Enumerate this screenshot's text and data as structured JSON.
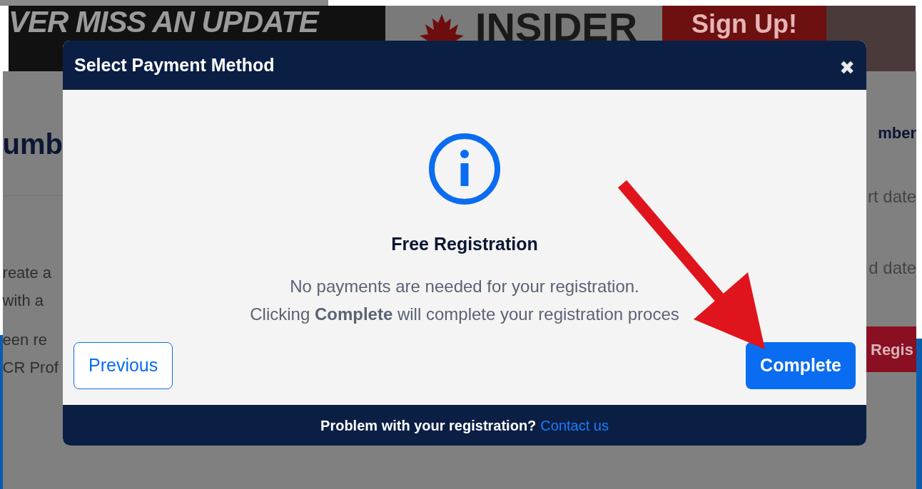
{
  "background_page": {
    "banner": {
      "slogan": "VER MISS AN UPDATE",
      "brand": "INSIDER",
      "cta": "Sign Up!"
    },
    "left_texts": {
      "heading": "umb",
      "lines": [
        "reate a",
        "with a",
        "een re",
        "CR Prof"
      ]
    },
    "right_texts": {
      "heading": "mber",
      "fields": [
        "rt date",
        "d date"
      ],
      "button": "Regis"
    }
  },
  "modal": {
    "title": "Select Payment Method",
    "close": "✖",
    "heading": "Free Registration",
    "message": [
      "No payments are needed for your registration.",
      "Clicking **Complete** will complete your registration proces"
    ],
    "buttons": [
      {
        "label": "Previous",
        "kind": "outline"
      },
      {
        "label": "Complete",
        "kind": "primary"
      }
    ],
    "footer": {
      "text": "Problem with your registration?",
      "link": "Contact us"
    }
  }
}
